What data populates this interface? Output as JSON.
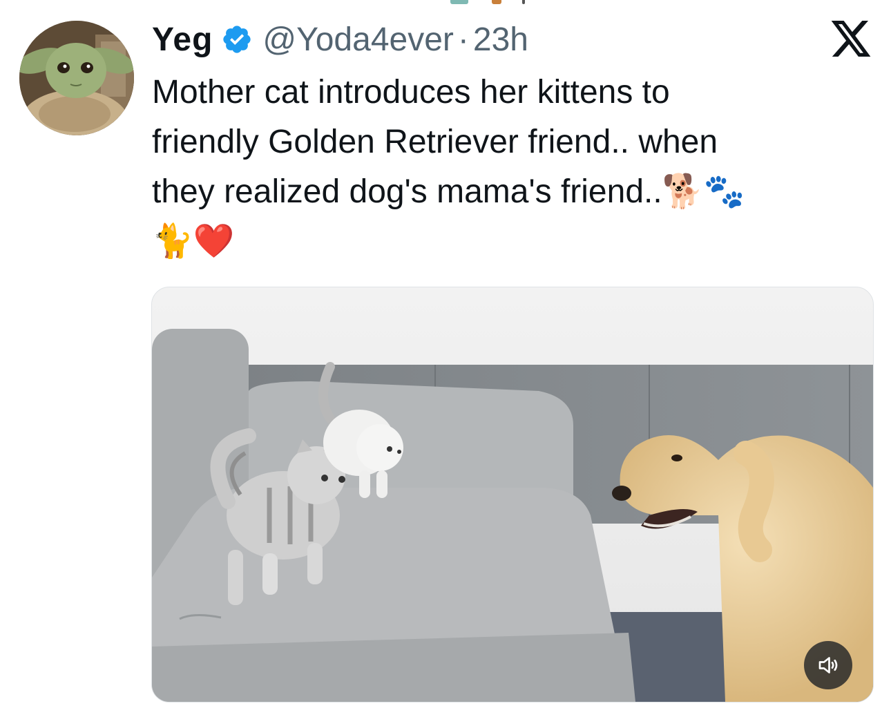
{
  "tweet": {
    "author_name": "Yeg",
    "handle": "@Yoda4ever",
    "separator": "·",
    "timestamp": "23h",
    "text": "Mother cat introduces her kittens to\nfriendly Golden Retriever friend.. when\nthey realized dog's mama's friend..🐕🐾\n🐈❤️"
  },
  "icons": {
    "verified": "verified-badge-icon",
    "platform": "x-logo-icon",
    "volume": "speaker-icon"
  },
  "colors": {
    "text": "#0f1419",
    "muted": "#536471",
    "verified": "#1d9bf0"
  }
}
